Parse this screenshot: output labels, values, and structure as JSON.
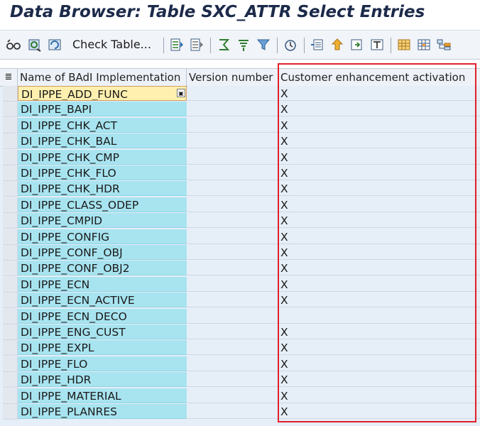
{
  "window": {
    "title": "Data Browser: Table SXC_ATTR Select Entries"
  },
  "toolbar": {
    "check_table_label": "Check Table...",
    "icons": [
      "glasses-icon",
      "refresh-icon",
      "details-icon",
      "sort-asc-icon",
      "sort-desc-icon",
      "filter-icon",
      "total-icon",
      "print-icon",
      "export-icon",
      "upload-icon",
      "layout-icon",
      "grid-icon",
      "tree-icon",
      "hierarchy-icon",
      "settings-icon",
      "view-icon"
    ]
  },
  "table": {
    "columns": [
      "Name of BAdI Implementation",
      "Version number",
      "Customer enhancement activation"
    ],
    "rows": [
      {
        "name": "DI_IPPE_ADD_FUNC",
        "version": "",
        "activation": "X"
      },
      {
        "name": "DI_IPPE_BAPI",
        "version": "",
        "activation": "X"
      },
      {
        "name": "DI_IPPE_CHK_ACT",
        "version": "",
        "activation": "X"
      },
      {
        "name": "DI_IPPE_CHK_BAL",
        "version": "",
        "activation": "X"
      },
      {
        "name": "DI_IPPE_CHK_CMP",
        "version": "",
        "activation": "X"
      },
      {
        "name": "DI_IPPE_CHK_FLO",
        "version": "",
        "activation": "X"
      },
      {
        "name": "DI_IPPE_CHK_HDR",
        "version": "",
        "activation": "X"
      },
      {
        "name": "DI_IPPE_CLASS_ODEP",
        "version": "",
        "activation": "X"
      },
      {
        "name": "DI_IPPE_CMPID",
        "version": "",
        "activation": "X"
      },
      {
        "name": "DI_IPPE_CONFIG",
        "version": "",
        "activation": "X"
      },
      {
        "name": "DI_IPPE_CONF_OBJ",
        "version": "",
        "activation": "X"
      },
      {
        "name": "DI_IPPE_CONF_OBJ2",
        "version": "",
        "activation": "X"
      },
      {
        "name": "DI_IPPE_ECN",
        "version": "",
        "activation": "X"
      },
      {
        "name": "DI_IPPE_ECN_ACTIVE",
        "version": "",
        "activation": "X"
      },
      {
        "name": "DI_IPPE_ECN_DECO",
        "version": "",
        "activation": ""
      },
      {
        "name": "DI_IPPE_ENG_CUST",
        "version": "",
        "activation": "X"
      },
      {
        "name": "DI_IPPE_EXPL",
        "version": "",
        "activation": "X"
      },
      {
        "name": "DI_IPPE_FLO",
        "version": "",
        "activation": "X"
      },
      {
        "name": "DI_IPPE_HDR",
        "version": "",
        "activation": "X"
      },
      {
        "name": "DI_IPPE_MATERIAL",
        "version": "",
        "activation": "X"
      },
      {
        "name": "DI_IPPE_PLANRES",
        "version": "",
        "activation": "X"
      }
    ]
  },
  "colors": {
    "highlight": "#e0202a",
    "key_column": "#a8e4f0",
    "selected_cell": "#fff0b0"
  }
}
